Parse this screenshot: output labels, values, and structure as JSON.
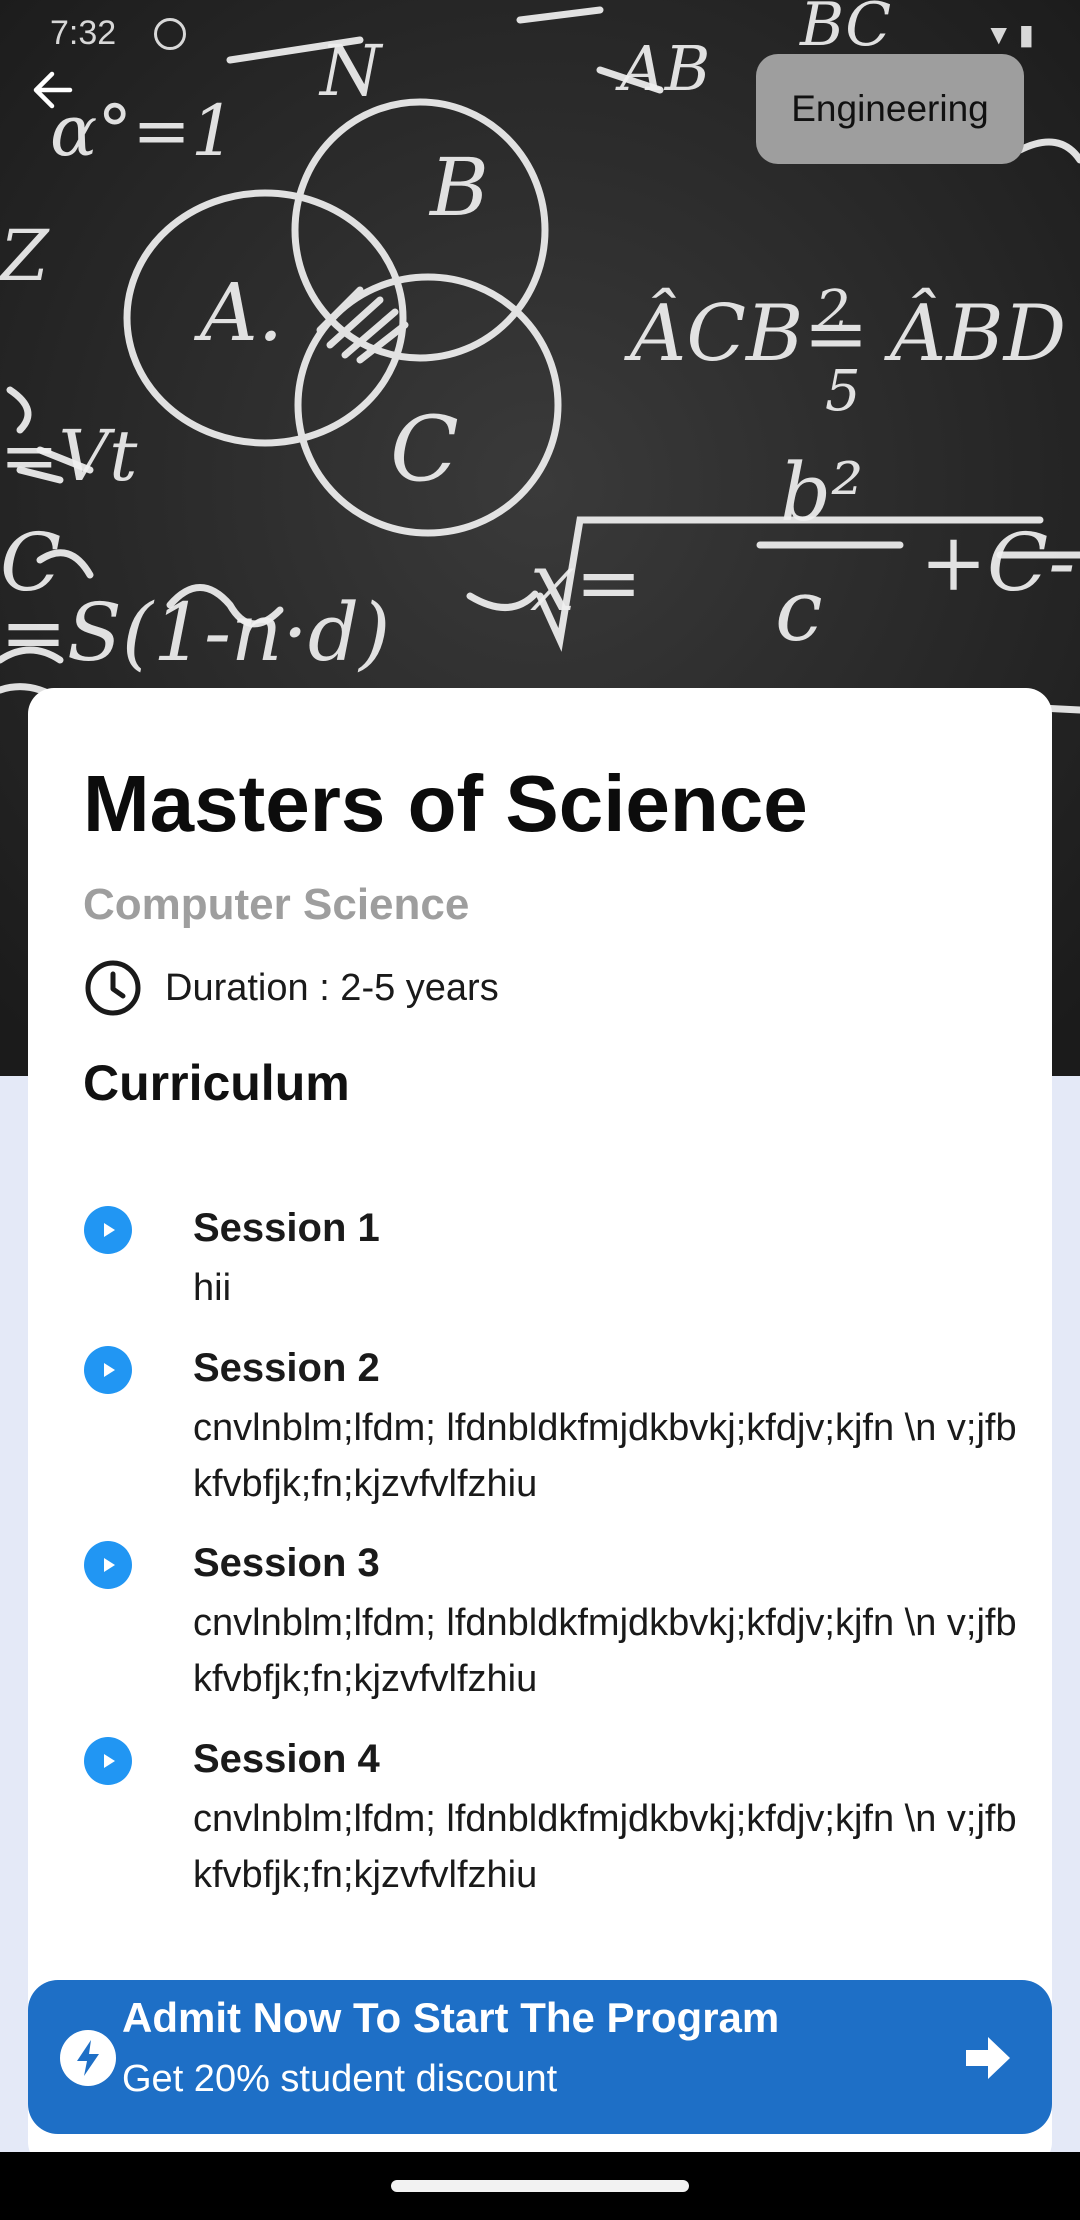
{
  "status_bar": {
    "time": "7:32"
  },
  "header": {
    "category": "Engineering",
    "back_icon": "back-arrow-icon"
  },
  "program": {
    "title": "Masters of Science",
    "subtitle": "Computer Science",
    "duration": "Duration : 2-5 years"
  },
  "curriculum": {
    "heading": "Curriculum",
    "sessions": [
      {
        "title": "Session 1",
        "description": "hii"
      },
      {
        "title": "Session 2",
        "description": "cnvlnblm;lfdm; lfdnbldkfmjdkbvkj;kfdjv;kjfn \\n v;jfbkfvbfjk;fn;kjzvfvlfzhiu"
      },
      {
        "title": "Session 3",
        "description": "cnvlnblm;lfdm; lfdnbldkfmjdkbvkj;kfdjv;kjfn \\n v;jfbkfvbfjk;fn;kjzvfvlfzhiu"
      },
      {
        "title": "Session 4",
        "description": "cnvlnblm;lfdm; lfdnbldkfmjdkbvkj;kfdjv;kjfn \\n v;jfbkfvbfjk;fn;kjzvfvlfzhiu"
      }
    ]
  },
  "cta": {
    "title": "Admit Now To Start The Program",
    "subtitle": "Get 20% student discount"
  },
  "colors": {
    "accent": "#2196f3",
    "cta_background": "#1e6fc6",
    "chip_background": "#9e9e9e",
    "page_background": "#e4e9f7"
  }
}
